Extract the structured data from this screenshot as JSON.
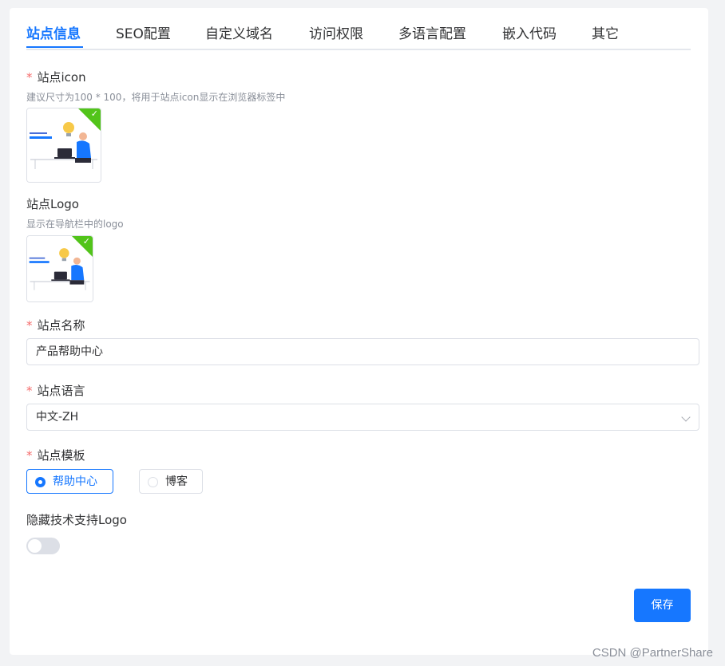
{
  "tabs": [
    {
      "label": "站点信息",
      "active": true
    },
    {
      "label": "SEO配置"
    },
    {
      "label": "自定义域名"
    },
    {
      "label": "访问权限"
    },
    {
      "label": "多语言配置"
    },
    {
      "label": "嵌入代码"
    },
    {
      "label": "其它"
    }
  ],
  "site_icon": {
    "required_mark": "*",
    "label": "站点icon",
    "hint": "建议尺寸为100 * 100，将用于站点icon显示在浏览器标签中",
    "image_icon": "help-center-illustration",
    "status_icon": "check-icon"
  },
  "site_logo": {
    "label": "站点Logo",
    "hint": "显示在导航栏中的logo",
    "image_icon": "help-center-illustration",
    "status_icon": "check-icon"
  },
  "site_name": {
    "required_mark": "*",
    "label": "站点名称",
    "value": "产品帮助中心"
  },
  "site_language": {
    "required_mark": "*",
    "label": "站点语言",
    "value": "中文-ZH"
  },
  "site_template": {
    "required_mark": "*",
    "label": "站点模板",
    "options": [
      {
        "label": "帮助中心",
        "checked": true
      },
      {
        "label": "博客",
        "checked": false
      }
    ]
  },
  "hide_logo": {
    "label": "隐藏技术支持Logo",
    "enabled": false
  },
  "save_label": "保存",
  "watermark": "CSDN @PartnerShare",
  "colors": {
    "primary": "#1677ff",
    "required": "#f56c6c",
    "success": "#52c41a"
  }
}
